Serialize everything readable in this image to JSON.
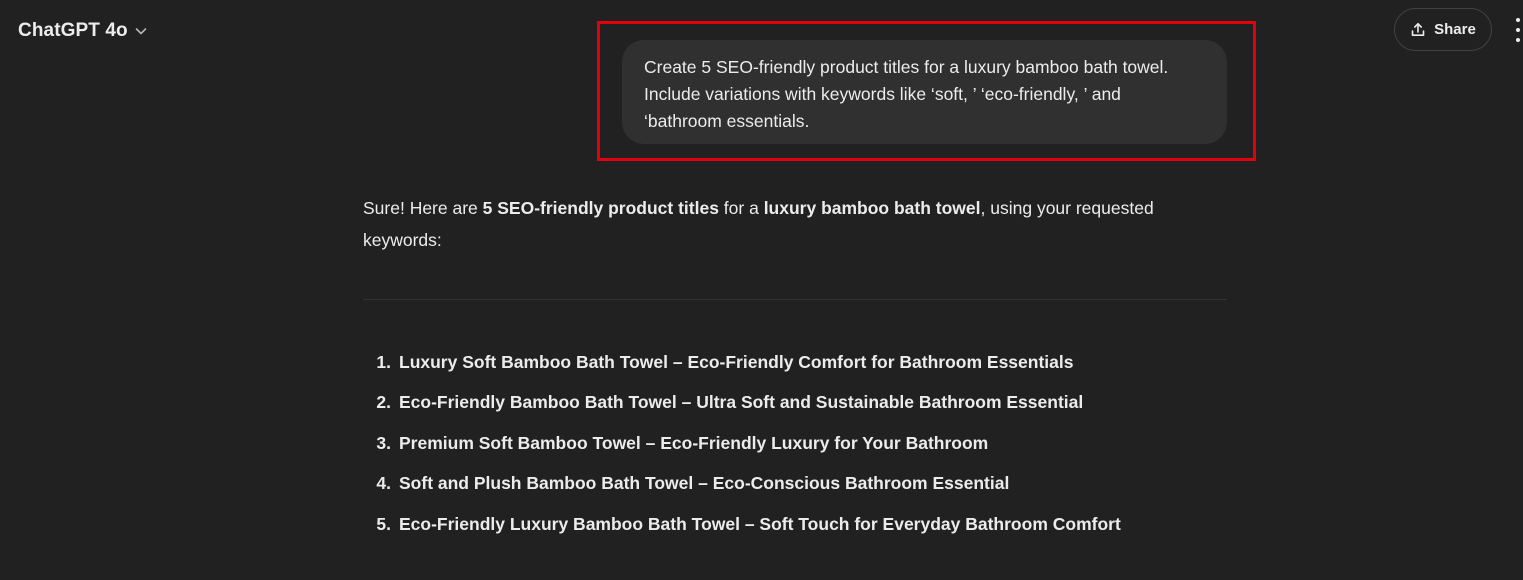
{
  "header": {
    "model_name": "ChatGPT 4o",
    "share_label": "Share"
  },
  "user_message": {
    "lines": [
      "Create 5 SEO-friendly product titles for a luxury bamboo bath towel.",
      "Include variations with keywords like ‘soft, ’ ‘eco-friendly, ’ and",
      "‘bathroom essentials."
    ]
  },
  "assistant": {
    "intro": {
      "part1": "Sure! Here are ",
      "bold1": "5 SEO-friendly product titles",
      "part2": " for a ",
      "bold2": "luxury bamboo bath towel",
      "part3": ", using your requested keywords:"
    },
    "titles": [
      {
        "number": "1.",
        "text": "Luxury Soft Bamboo Bath Towel – Eco-Friendly Comfort for Bathroom Essentials"
      },
      {
        "number": "2.",
        "text": "Eco-Friendly Bamboo Bath Towel – Ultra Soft and Sustainable Bathroom Essential"
      },
      {
        "number": "3.",
        "text": "Premium Soft Bamboo Towel – Eco-Friendly Luxury for Your Bathroom"
      },
      {
        "number": "4.",
        "text": "Soft and Plush Bamboo Bath Towel – Eco-Conscious Bathroom Essential"
      },
      {
        "number": "5.",
        "text": "Eco-Friendly Luxury Bamboo Bath Towel – Soft Touch for Everyday Bathroom Comfort"
      }
    ]
  },
  "icons": {
    "model_chevron": "chevron-down-icon",
    "share": "share-icon",
    "more": "more-vertical-icon"
  },
  "colors": {
    "background": "#212121",
    "user_bubble": "#303030",
    "highlight": "#e0000e",
    "text": "#ececec"
  }
}
